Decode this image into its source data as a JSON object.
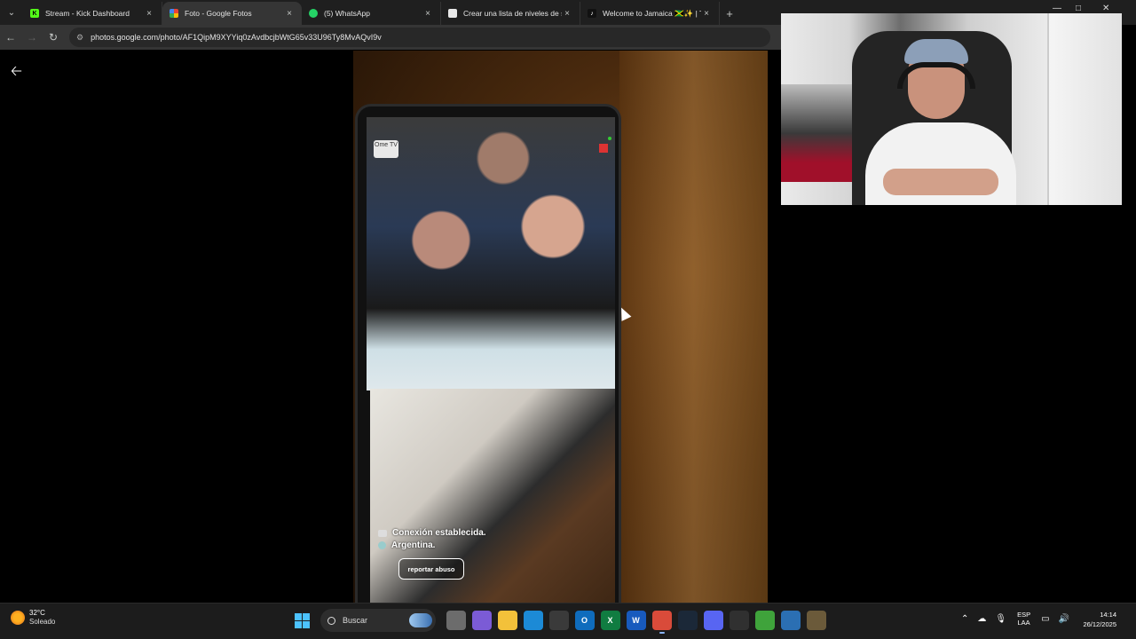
{
  "browser": {
    "tabs": [
      {
        "title": "Stream - Kick Dashboard",
        "icon": "kick-icon",
        "active": false
      },
      {
        "title": "Foto - Google Fotos",
        "icon": "google-photos-icon",
        "active": true
      },
      {
        "title": "(5) WhatsApp",
        "icon": "whatsapp-icon",
        "active": false
      },
      {
        "title": "Crear una lista de niveles de st",
        "icon": "tiermaker-icon",
        "active": false
      },
      {
        "title": "Welcome to Jamaica 🇯🇲✨ | Tik",
        "icon": "tiktok-icon",
        "active": false
      }
    ],
    "new_tab": "+",
    "url": "photos.google.com/photo/AF1QipM9XYYiq0zAvdbcjbWtG65v33U96Ty8MvAQvI9v"
  },
  "viewer": {
    "app_badge": "Ome TV",
    "connection_text": "Conexión establecida.",
    "country_text": "Argentina.",
    "report_button": "reportar abuso"
  },
  "taskbar": {
    "weather_temp": "32°C",
    "weather_desc": "Soleado",
    "search_placeholder": "Buscar",
    "apps": [
      {
        "name": "file-explorer-grey",
        "color": "#6c6c6c",
        "glyph": ""
      },
      {
        "name": "copilot-m365",
        "color": "#7b5bd6",
        "glyph": ""
      },
      {
        "name": "file-explorer",
        "color": "#f3c13a",
        "glyph": ""
      },
      {
        "name": "edge",
        "color": "#1c8ad6",
        "glyph": ""
      },
      {
        "name": "store",
        "color": "#3a3a3a",
        "glyph": ""
      },
      {
        "name": "outlook",
        "color": "#0f6cbd",
        "glyph": "O"
      },
      {
        "name": "excel",
        "color": "#107c41",
        "glyph": "X"
      },
      {
        "name": "word",
        "color": "#185abd",
        "glyph": "W"
      },
      {
        "name": "chrome",
        "color": "#d94b3a",
        "glyph": "",
        "active": true
      },
      {
        "name": "steam",
        "color": "#1b2838",
        "glyph": ""
      },
      {
        "name": "discord",
        "color": "#5865f2",
        "glyph": ""
      },
      {
        "name": "obs",
        "color": "#303030",
        "glyph": ""
      },
      {
        "name": "xbox",
        "color": "#3fa33b",
        "glyph": ""
      },
      {
        "name": "vpn",
        "color": "#2b6fb3",
        "glyph": ""
      },
      {
        "name": "minecraft",
        "color": "#6b5a3a",
        "glyph": ""
      }
    ],
    "lang_1": "ESP",
    "lang_2": "LAA",
    "time": "14:14",
    "date": "26/12/2025"
  }
}
